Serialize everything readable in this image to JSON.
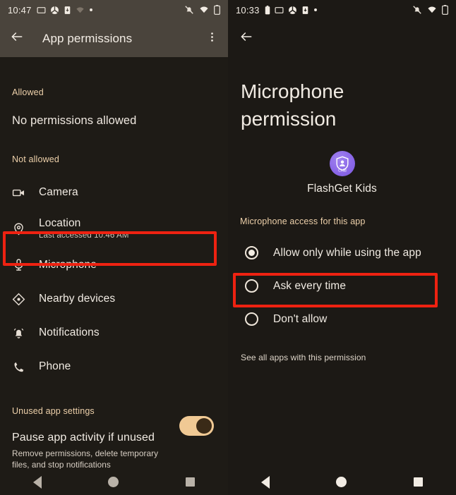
{
  "left": {
    "status": {
      "time": "10:47",
      "left_icons": [
        "cast-icon",
        "circle-badge-icon",
        "phone-download-icon",
        "weak-wifi-icon",
        "dot-icon"
      ],
      "right_icons": [
        "notifications-muted-icon",
        "wifi-icon",
        "battery-icon"
      ]
    },
    "appbar": {
      "back": "back-arrow-icon",
      "title": "App permissions",
      "overflow": "more-options-icon"
    },
    "allowed": {
      "label": "Allowed",
      "empty_text": "No permissions allowed"
    },
    "not_allowed": {
      "label": "Not allowed",
      "items": [
        {
          "icon": "camera-icon",
          "label": "Camera",
          "sub": ""
        },
        {
          "icon": "location-pin-icon",
          "label": "Location",
          "sub": "Last accessed 10:46 AM"
        },
        {
          "icon": "microphone-icon",
          "label": "Microphone",
          "sub": "",
          "highlighted": true
        },
        {
          "icon": "nearby-devices-icon",
          "label": "Nearby devices",
          "sub": ""
        },
        {
          "icon": "bell-icon",
          "label": "Notifications",
          "sub": ""
        },
        {
          "icon": "phone-icon",
          "label": "Phone",
          "sub": ""
        }
      ]
    },
    "unused": {
      "label": "Unused app settings",
      "title": "Pause app activity if unused",
      "description": "Remove permissions, delete temporary files, and stop notifications",
      "toggle_on": true
    },
    "nav": [
      "back-nav-icon",
      "home-nav-icon",
      "recents-nav-icon"
    ]
  },
  "right": {
    "status": {
      "time": "10:33",
      "left_icons": [
        "battery-small-icon",
        "cast-icon",
        "circle-badge-icon",
        "phone-download-icon",
        "dot-icon"
      ],
      "right_icons": [
        "notifications-muted-icon",
        "wifi-icon",
        "battery-icon"
      ]
    },
    "back": "back-arrow-icon",
    "title": "Microphone permission",
    "app": {
      "icon": "flashget-kids-shield-icon",
      "icon_badge_text": "Child",
      "name": "FlashGet Kids"
    },
    "access": {
      "label": "Microphone access for this app",
      "options": [
        {
          "label": "Allow only while using the app",
          "selected": true,
          "highlighted": true
        },
        {
          "label": "Ask every time",
          "selected": false
        },
        {
          "label": "Don't allow",
          "selected": false
        }
      ]
    },
    "see_all_link": "See all apps with this permission",
    "nav": [
      "back-nav-icon",
      "home-nav-icon",
      "recents-nav-icon"
    ]
  },
  "colors": {
    "highlight": "#ee2211",
    "accent_tan": "#edd0aa",
    "toggle_on": "#f0c994",
    "app_icon_purple": "#8b68e8"
  }
}
